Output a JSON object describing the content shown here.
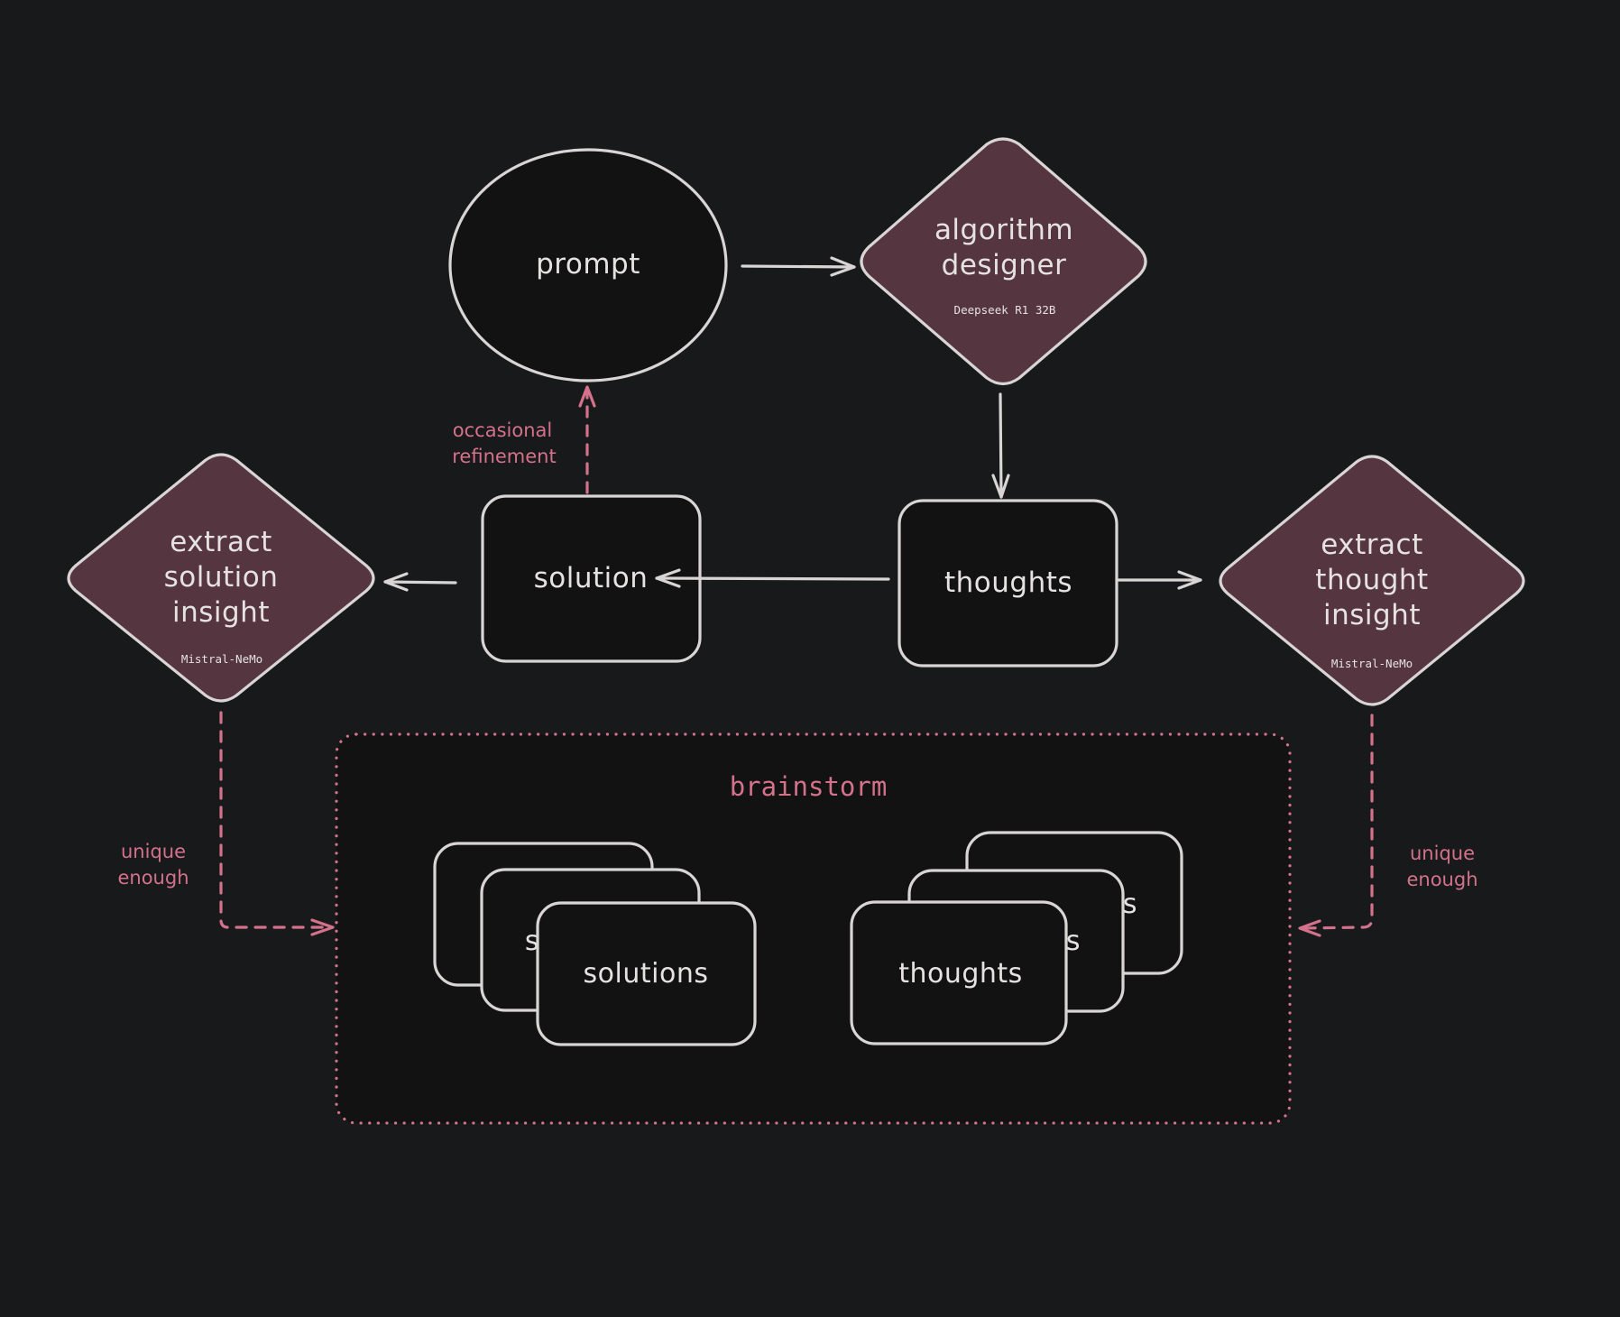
{
  "canvas": {
    "background": "#18191b",
    "stroke_color": "#d9d5d5",
    "node_fill": "#121212",
    "diamond_fill": "#553540",
    "accent_pink": "#d3728a"
  },
  "nodes": {
    "prompt": {
      "label": "prompt",
      "shape": "ellipse"
    },
    "algorithm_designer": {
      "label_lines": [
        "algorithm",
        "designer"
      ],
      "model": "Deepseek R1 32B",
      "shape": "diamond"
    },
    "thoughts": {
      "label": "thoughts",
      "shape": "rectangle"
    },
    "solution": {
      "label": "solution",
      "shape": "rectangle"
    },
    "extract_solution_insight": {
      "label_lines": [
        "extract",
        "solution",
        "insight"
      ],
      "model": "Mistral-NeMo",
      "shape": "diamond"
    },
    "extract_thought_insight": {
      "label_lines": [
        "extract",
        "thought",
        "insight"
      ],
      "model": "Mistral-NeMo",
      "shape": "diamond"
    }
  },
  "brainstorm": {
    "title": "brainstorm",
    "solutions_stack": {
      "label": "solutions",
      "hidden_partial": "s",
      "count": 3
    },
    "thoughts_stack": {
      "label": "thoughts",
      "hidden_partial": "s",
      "count": 3
    }
  },
  "edges": {
    "prompt_to_algorithm": {
      "from": "prompt",
      "to": "algorithm designer",
      "style": "solid"
    },
    "algorithm_to_thoughts": {
      "from": "algorithm designer",
      "to": "thoughts",
      "style": "solid"
    },
    "thoughts_to_solution": {
      "from": "thoughts",
      "to": "solution",
      "style": "solid"
    },
    "solution_to_extract": {
      "from": "solution",
      "to": "extract solution insight",
      "style": "solid"
    },
    "thoughts_to_extract": {
      "from": "thoughts",
      "to": "extract thought insight",
      "style": "solid"
    },
    "solution_to_prompt": {
      "from": "solution",
      "to": "prompt",
      "style": "dashed",
      "label_lines": [
        "occasional",
        "refinement"
      ]
    },
    "solution_insight_to_brainstorm": {
      "from": "extract solution insight",
      "to": "brainstorm",
      "style": "dashed",
      "label_lines": [
        "unique",
        "enough"
      ]
    },
    "thought_insight_to_brainstorm": {
      "from": "extract thought insight",
      "to": "brainstorm",
      "style": "dashed",
      "label_lines": [
        "unique",
        "enough"
      ]
    }
  }
}
